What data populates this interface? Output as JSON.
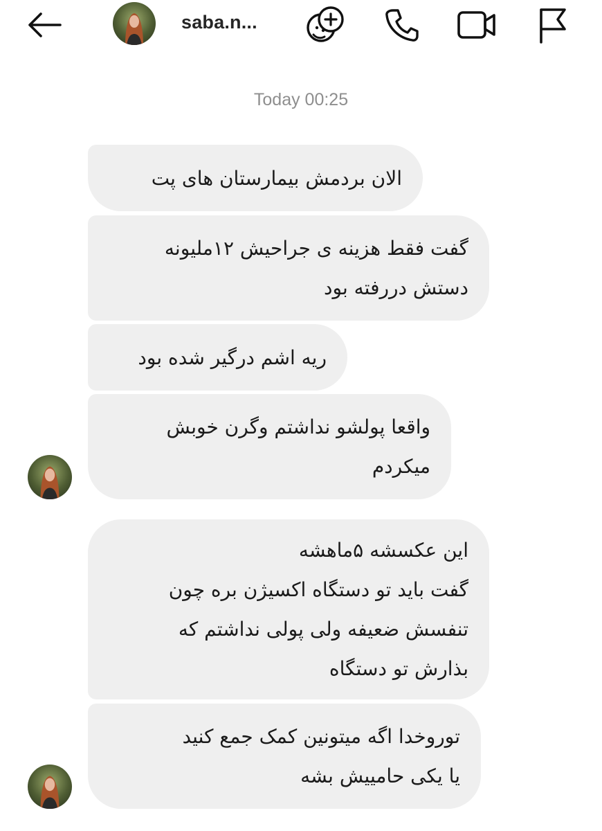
{
  "header": {
    "username": "saba.n...",
    "icons": {
      "back": "arrow-left-icon",
      "effects": "sticker-smiley-plus-icon",
      "call": "phone-icon",
      "video": "video-camera-icon",
      "report": "flag-icon"
    }
  },
  "thread": {
    "timestamp": "Today 00:25",
    "messages": [
      {
        "lines": [
          "الان بردمش بیمارستان های پت"
        ]
      },
      {
        "lines": [
          "گفت فقط هزینه ی جراحیش ۱۲ملیونه",
          "دستش دررفته بود"
        ]
      },
      {
        "lines": [
          "ریه اشم درگیر شده بود"
        ]
      },
      {
        "lines": [
          "واقعا پولشو نداشتم وگرن خوبش",
          "میکردم"
        ]
      },
      {
        "lines": [
          "این عکسشه ۵ماهشه",
          "گفت باید تو دستگاه اکسیژن بره چون",
          "تنفسش ضعیفه ولی پولی نداشتم که",
          "بذارش تو دستگاه"
        ]
      },
      {
        "lines": [
          "توروخدا اگه میتونین  کمک جمع کنید",
          "یا یکی حامییش بشه"
        ]
      }
    ]
  },
  "colors": {
    "bubble": "#efefef",
    "timestamp": "#8e8e8e",
    "icon": "#111111"
  }
}
